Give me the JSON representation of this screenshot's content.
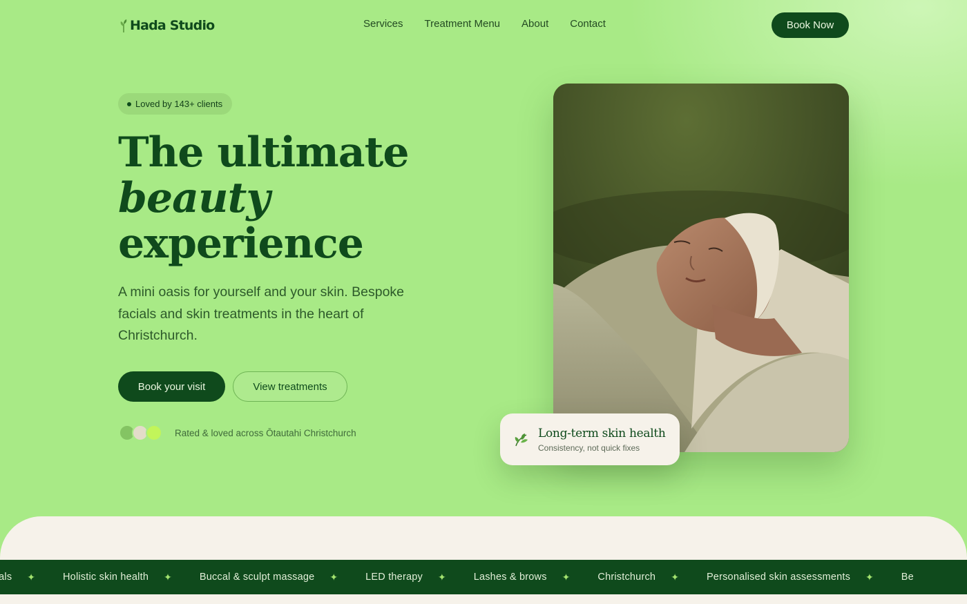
{
  "brand": {
    "name": "Hada Studio"
  },
  "nav": {
    "items": [
      "Services",
      "Treatment Menu",
      "About",
      "Contact"
    ],
    "cta": "Book Now"
  },
  "hero": {
    "badge": "Loved by 143+ clients",
    "headline": {
      "line1": "The ultimate",
      "line2": "beauty",
      "line3": "experience"
    },
    "subtext": "A mini oasis for yourself and your skin. Bespoke facials and skin treatments in the heart of Christchurch.",
    "primary_button": "Book your visit",
    "secondary_button": "View treatments",
    "rating_text": "Rated & loved across Ōtautahi Christchurch"
  },
  "feature_card": {
    "icon": "leaf-icon",
    "title": "Long-term skin health",
    "subtitle": "Consistency, not quick fixes"
  },
  "ticker": {
    "items": [
      "acials",
      "Holistic skin health",
      "Buccal & sculpt massage",
      "LED therapy",
      "Lashes & brows",
      "Christchurch",
      "Personalised skin assessments",
      "Be"
    ],
    "separator": "✦"
  },
  "colors": {
    "background": "#a8ea86",
    "primary": "#0f4a1c",
    "cream": "#f6f2ea",
    "accent_star": "#a3e36f"
  }
}
